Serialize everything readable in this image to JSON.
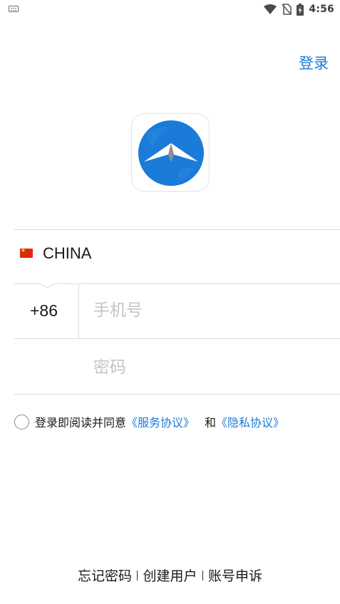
{
  "status_bar": {
    "time": "4:56",
    "icons": [
      "keyboard-icon",
      "wifi-icon",
      "no-sim-icon",
      "battery-charging-icon"
    ]
  },
  "header": {
    "login_label": "登录"
  },
  "logo": {
    "icon": "app-logo-icon",
    "colors": {
      "circle": "#1b7bd8",
      "wing": "#ffffff",
      "core": "#8a8a8a"
    }
  },
  "form": {
    "country": {
      "flag": "china-flag-icon",
      "name": "CHINA"
    },
    "phone": {
      "code": "+86",
      "placeholder": "手机号",
      "value": ""
    },
    "password": {
      "placeholder": "密码",
      "value": ""
    }
  },
  "agreement": {
    "checked": false,
    "prefix": "登录即阅读并同意",
    "service_link": "《服务协议》",
    "conjunction": "和",
    "privacy_link": "《隐私协议》"
  },
  "footer": {
    "links": [
      "忘记密码",
      "创建用户",
      "账号申诉"
    ]
  },
  "colors": {
    "accent": "#1b7bd8",
    "divider": "#dcdcdc",
    "placeholder": "#c4c4c4"
  }
}
